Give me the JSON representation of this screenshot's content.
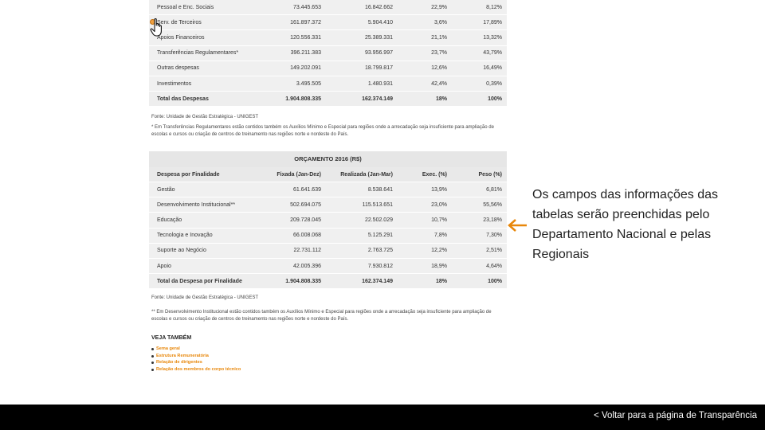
{
  "table1": {
    "rows": [
      {
        "label": "Pessoal e Enc. Sociais",
        "fixada": "73.445.653",
        "realizada": "16.842.662",
        "exec": "22,9%",
        "peso": "8,12%"
      },
      {
        "label": "Serv. de Terceiros",
        "fixada": "161.897.372",
        "realizada": "5.904.410",
        "exec": "3,6%",
        "peso": "17,89%"
      },
      {
        "label": "Apoios Financeiros",
        "fixada": "120.556.331",
        "realizada": "25.389.331",
        "exec": "21,1%",
        "peso": "13,32%"
      },
      {
        "label": "Transferências Regulamentares*",
        "fixada": "396.211.383",
        "realizada": "93.956.997",
        "exec": "23,7%",
        "peso": "43,79%"
      },
      {
        "label": "Outras despesas",
        "fixada": "149.202.091",
        "realizada": "18.799.817",
        "exec": "12,6%",
        "peso": "16,49%"
      },
      {
        "label": "Investimentos",
        "fixada": "3.495.505",
        "realizada": "1.480.931",
        "exec": "42,4%",
        "peso": "0,39%"
      }
    ],
    "total": {
      "label": "Total das Despesas",
      "fixada": "1.904.808.335",
      "realizada": "162.374.149",
      "exec": "18%",
      "peso": "100%"
    },
    "fonte": "Fonte: Unidade de Gestão Estratégica - UNIGEST",
    "note": "* Em Transferências Regulamentares estão contidos também os Auxílios Mínimo e Especial para regiões onde a arrecadação seja insuficiente para ampliação de escolas e cursos ou criação de centros de treinamento nas regiões norte e nordeste do País."
  },
  "table2": {
    "title": "ORÇAMENTO 2016 (R$)",
    "headers": [
      "Despesa por Finalidade",
      "Fixada (Jan-Dez)",
      "Realizada (Jan-Mar)",
      "Exec. (%)",
      "Peso (%)"
    ],
    "rows": [
      {
        "label": "Gestão",
        "fixada": "61.641.639",
        "realizada": "8.538.641",
        "exec": "13,9%",
        "peso": "6,81%"
      },
      {
        "label": "Desenvolvimento Institucional**",
        "fixada": "502.694.075",
        "realizada": "115.513.651",
        "exec": "23,0%",
        "peso": "55,56%"
      },
      {
        "label": "Educação",
        "fixada": "209.728.045",
        "realizada": "22.502.029",
        "exec": "10,7%",
        "peso": "23,18%"
      },
      {
        "label": "Tecnologia e Inovação",
        "fixada": "66.008.068",
        "realizada": "5.125.291",
        "exec": "7,8%",
        "peso": "7,30%"
      },
      {
        "label": "Suporte ao Negócio",
        "fixada": "22.731.112",
        "realizada": "2.763.725",
        "exec": "12,2%",
        "peso": "2,51%"
      },
      {
        "label": "Apoio",
        "fixada": "42.005.396",
        "realizada": "7.930.812",
        "exec": "18,9%",
        "peso": "4,64%"
      }
    ],
    "total": {
      "label": "Total da Despesa por Finalidade",
      "fixada": "1.904.808.335",
      "realizada": "162.374.149",
      "exec": "18%",
      "peso": "100%"
    },
    "fonte": "Fonte: Unidade de Gestão Estratégica - UNIGEST",
    "note": "** Em Desenvolvimento Institucional estão contidos também os Auxílios Mínimo e Especial para regiões onde a arrecadação seja insuficiente para ampliação de escolas e cursos ou criação de centros de treinamento nas regiões norte e nordeste do País."
  },
  "veja_tambem": {
    "title": "VEJA TAMBÉM",
    "links": [
      "Sema geral",
      "Estrutura Remuneratória",
      "Relação de dirigentes",
      "Relação dos membros do corpo técnico"
    ]
  },
  "annotation": {
    "text": "Os campos das informações das tabelas serão preenchidas pelo Departamento Nacional e pelas Regionais"
  },
  "footer": {
    "back_link": "< Voltar para a página de Transparência"
  },
  "colors": {
    "accent": "#e8870a",
    "footer_bg": "#000000"
  },
  "icons": {
    "arrow": "left-arrow-icon",
    "cursor": "hand-pointer-icon"
  }
}
